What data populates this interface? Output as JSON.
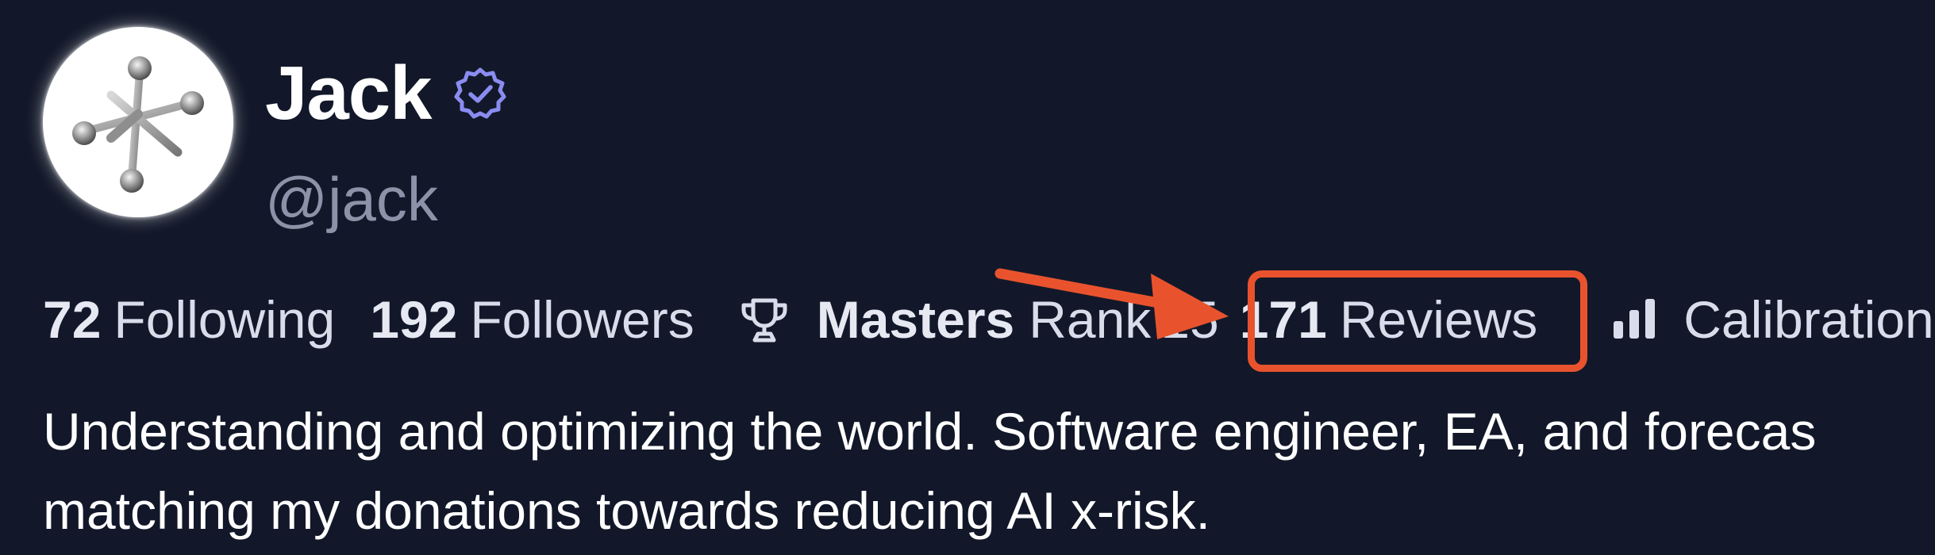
{
  "profile": {
    "name": "Jack",
    "handle": "@jack",
    "verified_icon": "verified-badge-icon",
    "avatar_icon": "jacks-toy-icon"
  },
  "stats": {
    "following_count": "72",
    "following_label": "Following",
    "followers_count": "192",
    "followers_label": "Followers",
    "rank_icon": "trophy-icon",
    "rank_tier": "Masters",
    "rank_word": "Rank",
    "rank_number": "15",
    "reviews_count": "171",
    "reviews_label": "Reviews",
    "calibration_icon": "bar-chart-icon",
    "calibration_label": "Calibration"
  },
  "bio": {
    "line1": "Understanding and optimizing the world. Software engineer, EA, and forecas",
    "line2": "matching my donations towards reducing AI x-risk."
  },
  "colors": {
    "background": "#121829",
    "accent_verified": "#8a8cf0",
    "highlight": "#e8532e",
    "muted": "#8c93a8"
  }
}
